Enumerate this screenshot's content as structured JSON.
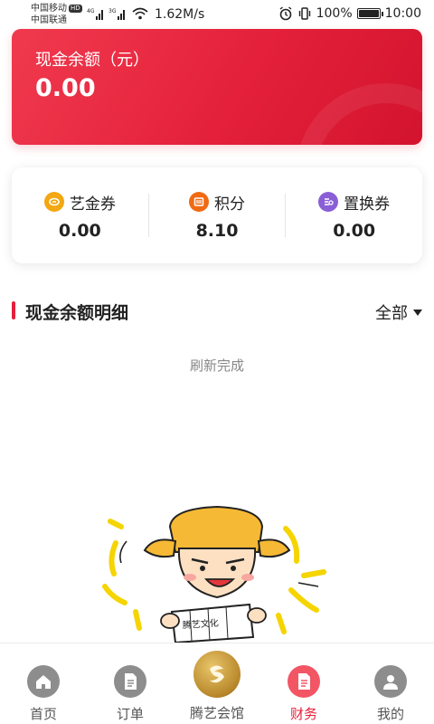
{
  "status": {
    "carrier1": "中国移动",
    "hd": "HD",
    "carrier2": "中国联通",
    "net_speed": "1.62M/s",
    "battery": "100%",
    "time": "10:00",
    "battery_level": 1.0
  },
  "balance": {
    "label": "现金余额（元）",
    "value": "0.00"
  },
  "stats": [
    {
      "label": "艺金券",
      "value": "0.00",
      "icon": "coupon-icon",
      "color": "#f3a712"
    },
    {
      "label": "积分",
      "value": "8.10",
      "icon": "points-icon",
      "color": "#f06a13"
    },
    {
      "label": "置换券",
      "value": "0.00",
      "icon": "exchange-coupon-icon",
      "color": "#8a5fd6"
    }
  ],
  "detail": {
    "title": "现金余额明细",
    "filter": "全部"
  },
  "refresh_text": "刷新完成",
  "illustration_text": "腾艺文化",
  "tabs": [
    {
      "label": "首页",
      "icon": "home-icon"
    },
    {
      "label": "订单",
      "icon": "order-icon"
    },
    {
      "label": "腾艺会馆",
      "icon": "club-logo-icon"
    },
    {
      "label": "财务",
      "icon": "finance-icon"
    },
    {
      "label": "我的",
      "icon": "profile-icon"
    }
  ],
  "colors": {
    "accent": "#e4203a",
    "tab_inactive": "#555555"
  }
}
